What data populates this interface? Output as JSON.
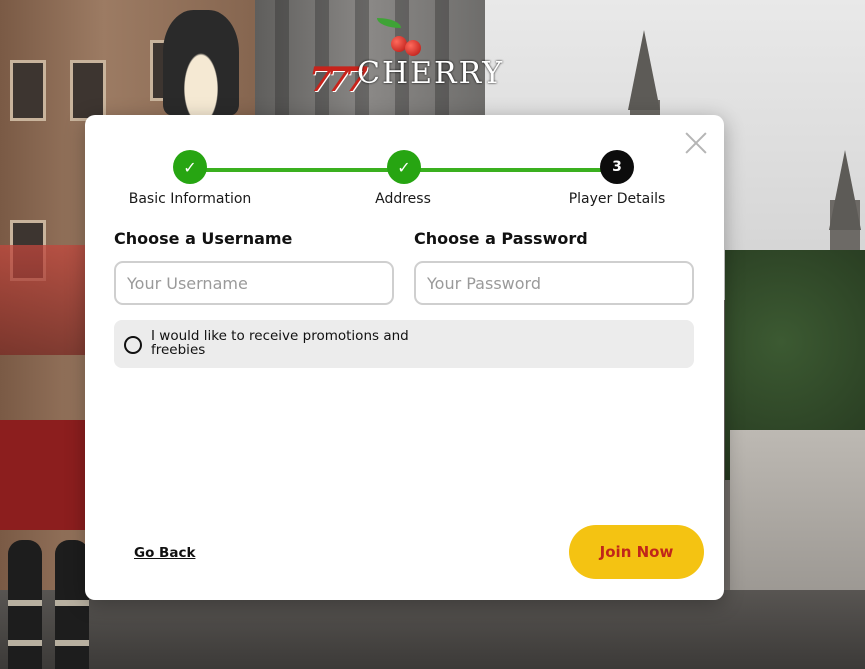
{
  "brand": {
    "logo_text": "CHERRY",
    "logo_sevens": "777"
  },
  "wizard": {
    "steps": [
      {
        "label": "Basic Information",
        "status": "done",
        "mark": "✓"
      },
      {
        "label": "Address",
        "status": "done",
        "mark": "✓"
      },
      {
        "label": "Player Details",
        "status": "current",
        "mark": "3"
      }
    ]
  },
  "form": {
    "username_label": "Choose a Username",
    "username_placeholder": "Your Username",
    "username_value": "",
    "password_label": "Choose a Password",
    "password_placeholder": "Your Password",
    "password_value": "",
    "promo_text": "I would like to receive promotions and freebies",
    "promo_checked": false
  },
  "actions": {
    "back_label": "Go Back",
    "join_label": "Join Now"
  },
  "icons": {
    "close": "close-icon",
    "check": "check-icon",
    "radio": "radio-icon"
  },
  "colors": {
    "step_done": "#27a512",
    "step_current": "#0c0c0c",
    "join_button_bg": "#f4c312",
    "join_button_text": "#c0261a"
  }
}
